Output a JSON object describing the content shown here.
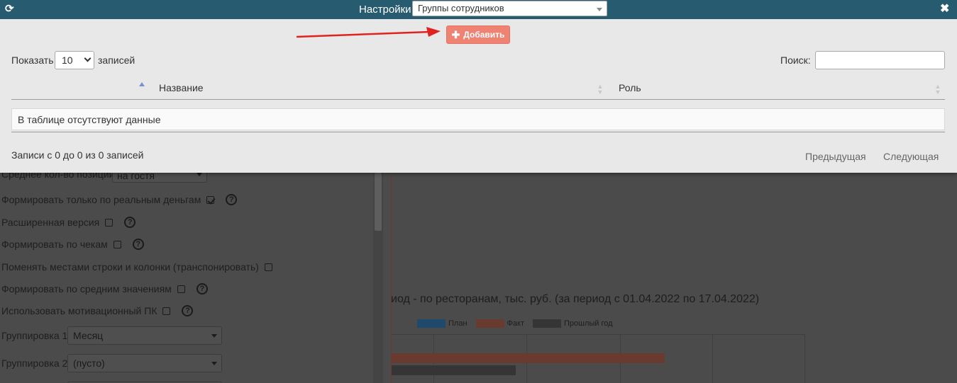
{
  "header": {
    "title": "Настройки",
    "select_value": "Группы сотрудников",
    "close_symbol": "✖",
    "refresh_symbol": "⟳"
  },
  "toolbar": {
    "add_label": "Добавить",
    "add_symbol": "✚"
  },
  "table_controls": {
    "show_label": "Показать",
    "length_value": "10",
    "records_label": "записей",
    "search_label": "Поиск:",
    "search_value": "",
    "search_placeholder": ""
  },
  "table": {
    "columns": [
      "Название",
      "Роль"
    ],
    "sort_symbol": "▲▼",
    "empty_text": "В таблице отсутствуют данные",
    "info": "Записи с 0 до 0 из 0 записей",
    "prev_label": "Предыдущая",
    "next_label": "Следующая"
  },
  "background": {
    "avg_label": "Среднее кол-во позиций",
    "avg_select": "на гостя",
    "options": [
      {
        "label": "Формировать только по реальным деньгам",
        "checked": true,
        "help": true
      },
      {
        "label": "Расширенная версия",
        "checked": false,
        "help": true
      },
      {
        "label": "Формировать по чекам",
        "checked": false,
        "help": true
      },
      {
        "label": "Поменять местами строки и колонки (транспонировать)",
        "checked": false,
        "help": false
      },
      {
        "label": "Формировать по средним значениям",
        "checked": false,
        "help": true
      },
      {
        "label": "Использовать мотивационный ПК",
        "checked": false,
        "help": true
      }
    ],
    "help_symbol": "?",
    "grouping1_label": "Группировка 1",
    "grouping1_value": "Месяц",
    "grouping2_label": "Группировка 2",
    "grouping2_value": "(пусто)"
  },
  "chart_data": {
    "type": "bar",
    "title": "иод - по ресторанам, тыс. руб. (за период с 01.04.2022 по 17.04.2022)",
    "series": [
      {
        "name": "План",
        "color": "#1f4a6b"
      },
      {
        "name": "Факт",
        "color": "#6b3a2e"
      },
      {
        "name": "Прошлый год",
        "color": "#353535"
      }
    ],
    "bars": [
      {
        "series": "Факт",
        "fraction": 0.66
      },
      {
        "series": "Прошлый год",
        "fraction": 0.3
      }
    ]
  },
  "colors": {
    "header_bg": "#275b6f",
    "accent_button": "#ef8373",
    "arrow": "#e1231f"
  }
}
